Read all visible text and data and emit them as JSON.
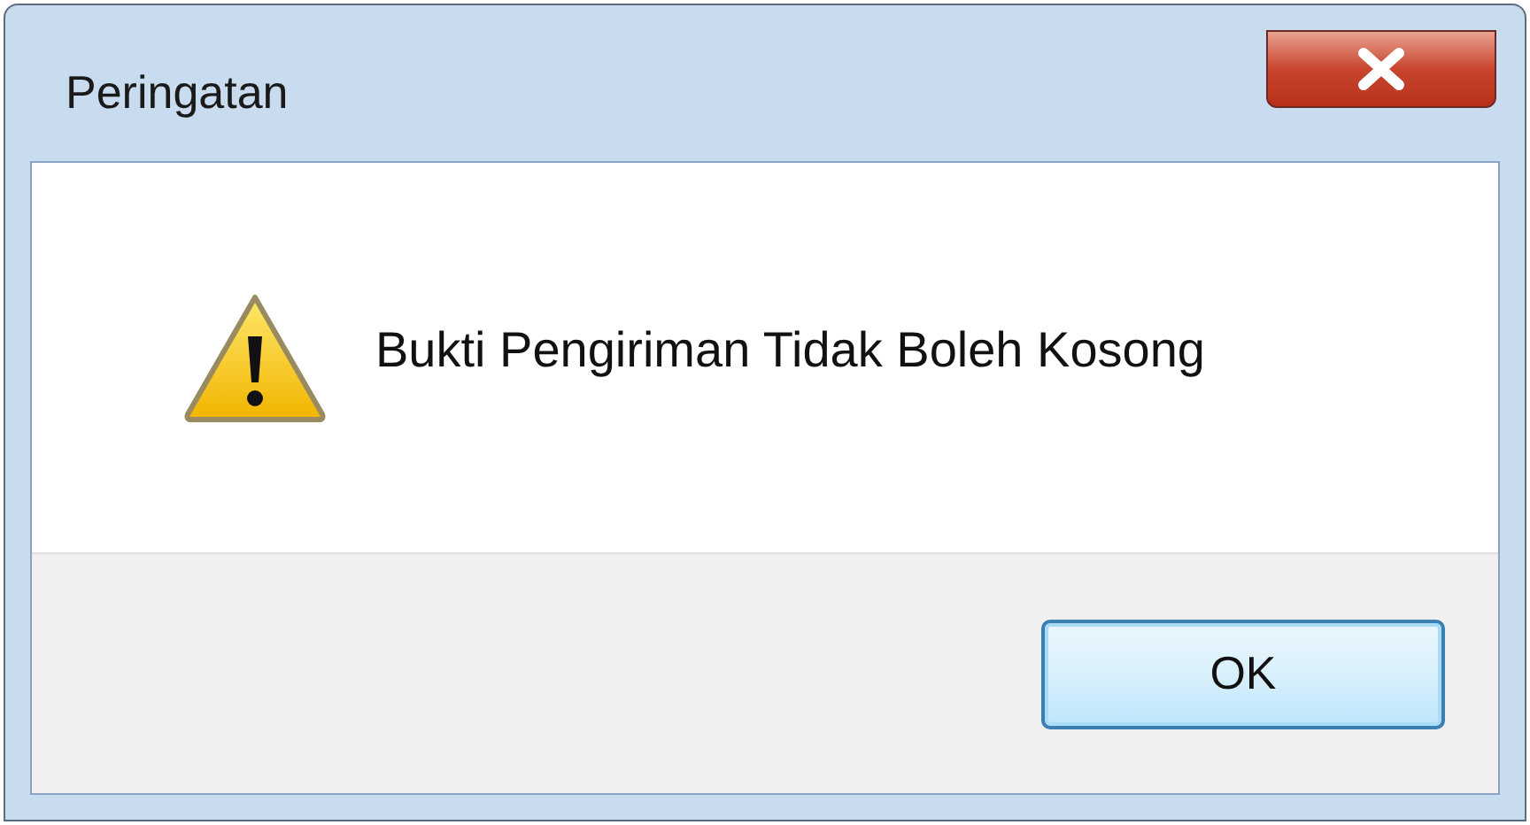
{
  "window": {
    "title": "Peringatan"
  },
  "message": "Bukti Pengiriman Tidak Boleh Kosong",
  "buttons": [
    {
      "label": "OK",
      "selected": true
    }
  ]
}
